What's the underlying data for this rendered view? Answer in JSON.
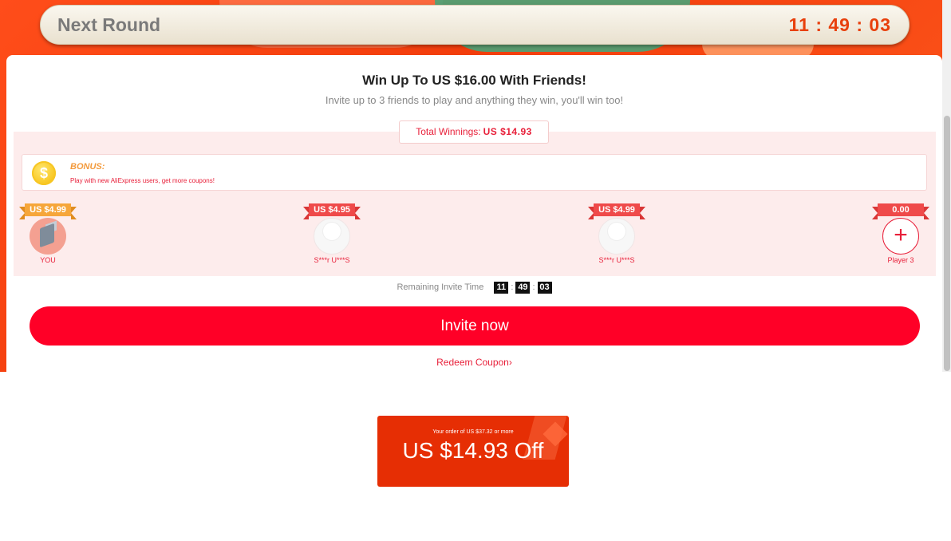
{
  "header": {
    "title": "Next Round",
    "timer": "11 : 49 : 03"
  },
  "card": {
    "title": "Win Up To US $16.00 With Friends!",
    "subtitle": "Invite up to 3 friends to play and anything they win, you'll win too!",
    "total_label": "Total Winnings:",
    "total_value": "US $14.93",
    "bonus": {
      "label": "BONUS:",
      "text": "Play with new AliExpress users, get more coupons!"
    },
    "players": [
      {
        "amount": "US $4.99",
        "name": "YOU"
      },
      {
        "amount": "US $4.95",
        "name": "S***r U***S"
      },
      {
        "amount": "US $4.99",
        "name": "S***r U***S"
      },
      {
        "amount": "0.00",
        "name": "Player 3"
      }
    ],
    "remaining_label": "Remaining Invite Time",
    "remaining": {
      "h": "11",
      "m": "49",
      "s": "03"
    },
    "invite_button": "Invite now",
    "redeem_link": "Redeem Coupon"
  },
  "coupon": {
    "condition": "Your order of US $37.32 or more",
    "amount": "US $14.93 Off"
  },
  "colors": {
    "accent": "#ff0027",
    "coupon": "#e62e04",
    "timer": "#e8400c"
  },
  "icons": {
    "bonus": "coin-icon",
    "add": "plus-icon",
    "redeem": "chevron-right-icon"
  }
}
